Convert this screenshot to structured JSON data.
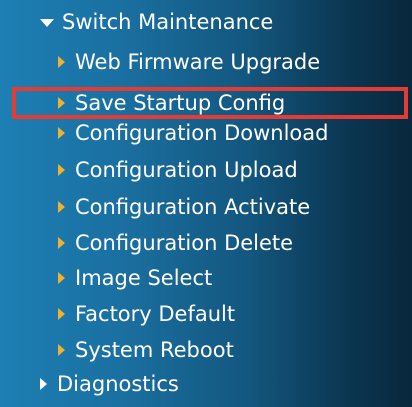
{
  "menu": {
    "header": {
      "label": "Switch Maintenance"
    },
    "items": [
      {
        "label": "Web Firmware Upgrade"
      },
      {
        "label": "Save Startup Config",
        "highlighted": true
      },
      {
        "label": "Configuration Download"
      },
      {
        "label": "Configuration Upload"
      },
      {
        "label": "Configuration Activate"
      },
      {
        "label": "Configuration Delete"
      },
      {
        "label": "Image Select"
      },
      {
        "label": "Factory Default"
      },
      {
        "label": "System Reboot"
      }
    ],
    "diagnostics": {
      "label": "Diagnostics"
    }
  },
  "colors": {
    "highlight_border": "#e23c34",
    "item_caret": "#f0b030",
    "text": "#ffffff"
  }
}
